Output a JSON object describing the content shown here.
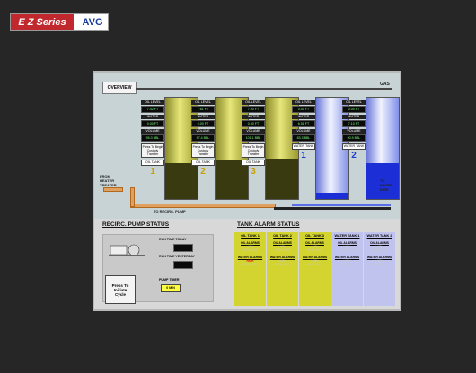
{
  "logo": {
    "series_text": "E Z Series",
    "brand_text": "AVG"
  },
  "screen": {
    "overview_button": "OVERVIEW",
    "gas_label": "GAS",
    "from_label": "FROM\nHEATER\nTREATER",
    "to_label": "TO\nWATER\nDISP.",
    "to_recirc_label": "TO RECIRC. PUMP",
    "tanks": [
      {
        "type": "oil",
        "number": "1",
        "oil_level": "7.42 FT",
        "water": "0.00 FT",
        "volume": "95.0 BBL",
        "press": "Press To Begin Custody Transfer",
        "name": "OIL TANK",
        "fill": 0.35
      },
      {
        "type": "oil",
        "number": "2",
        "oil_level": "7.61 FT",
        "water": "0.00 FT",
        "volume": "97.4 BBL",
        "press": "Press To Begin Custody Transfer",
        "name": "OIL TANK",
        "fill": 0.38
      },
      {
        "type": "oil",
        "number": "3",
        "oil_level": "7.90 FT",
        "water": "0.00 FT",
        "volume": "101.1 BBL",
        "press": "Press To Begin Custody Transfer",
        "name": "OIL TANK",
        "fill": 0.4
      },
      {
        "type": "water",
        "number": "1",
        "oil_level": "0.00 FT",
        "water": "6.51 FT",
        "volume": "83.3 BBL",
        "press": "",
        "name": "WATER TANK",
        "fill": 0.06
      },
      {
        "type": "water",
        "number": "2",
        "oil_level": "0.00 FT",
        "water": "7.10 FT",
        "volume": "90.9 BBL",
        "press": "",
        "name": "WATER TANK",
        "fill": 0.35
      }
    ],
    "labels": {
      "oil_level": "OIL LEVEL",
      "water": "WATER",
      "volume": "VOLUME"
    }
  },
  "recirc": {
    "title": "RECIRC. PUMP STATUS",
    "run_today": "RUN TIME TODAY",
    "run_yesterday": "RUN TIME YESTERDAY",
    "init_button": [
      "Press To",
      "Initiate",
      "Cycle"
    ],
    "timer_label": "PUMP TIMER",
    "timer_value": "0 MIN"
  },
  "alarms": {
    "title": "TANK ALARM STATUS",
    "columns": [
      {
        "type": "oil",
        "name": "OIL TANK 1",
        "oil_alarms": "OIL ALARMS",
        "oil_vals": [
          "HIGH",
          "HIGH-HIGH"
        ],
        "water_alarms": "WATER ALARMS",
        "water_vals": [
          "HIGH",
          "HIGH-HIGH"
        ],
        "alert": true
      },
      {
        "type": "oil",
        "name": "OIL TANK 2",
        "oil_alarms": "OIL ALARMS",
        "oil_vals": [
          "HIGH",
          "HIGH-HIGH"
        ],
        "water_alarms": "WATER ALARMS",
        "water_vals": [
          "HIGH",
          "HIGH-HIGH"
        ],
        "alert": false
      },
      {
        "type": "oil",
        "name": "OIL TANK 3",
        "oil_alarms": "OIL ALARMS",
        "oil_vals": [
          "HIGH",
          "HIGH-HIGH"
        ],
        "water_alarms": "WATER ALARMS",
        "water_vals": [
          "HIGH",
          "HIGH-HIGH"
        ],
        "alert": false
      },
      {
        "type": "water",
        "name": "WATER TANK 1",
        "oil_alarms": "OIL ALARMS",
        "oil_vals": [
          "HIGH",
          "HIGH-HIGH"
        ],
        "water_alarms": "WATER ALARMS",
        "water_vals": [
          "HIGH",
          "HIGH-HIGH"
        ],
        "alert": false
      },
      {
        "type": "water",
        "name": "WATER TANK 2",
        "oil_alarms": "OIL ALARMS",
        "oil_vals": [
          "HIGH",
          "HIGH-HIGH"
        ],
        "water_alarms": "WATER ALARMS",
        "water_vals": [
          "HIGH",
          "HIGH-HIGH"
        ],
        "alert": false
      }
    ]
  }
}
